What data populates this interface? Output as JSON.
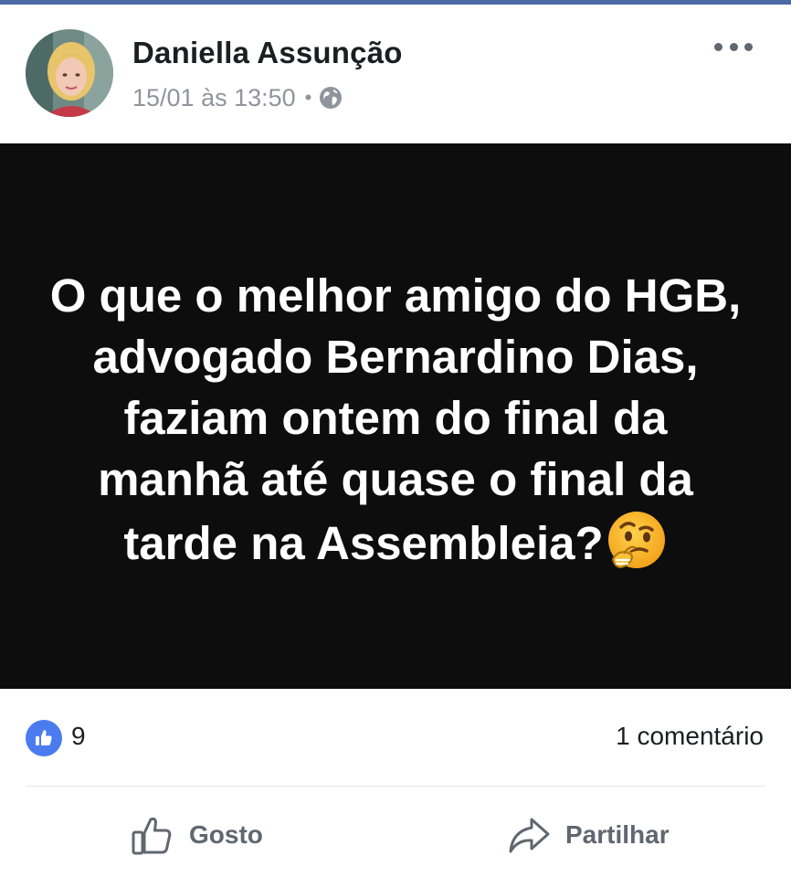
{
  "post": {
    "author": "Daniella Assunção",
    "timestamp": "15/01 às 13:50",
    "separator": "•",
    "privacy_icon": "globe-icon",
    "menu_icon": "more-options-icon",
    "image_text": "O que o melhor amigo do HGB, advogado Bernardino Dias, faziam ontem do final da manhã até quase o final da tarde na Assembleia?",
    "image_emoji": "thinking-face-emoji"
  },
  "stats": {
    "reaction_icon": "like-reaction-icon",
    "likes": "9",
    "comments": "1 comentário"
  },
  "actions": {
    "like_label": "Gosto",
    "like_icon": "thumbs-up-icon",
    "share_label": "Partilhar",
    "share_icon": "share-arrow-icon"
  },
  "colors": {
    "accent_bar": "#4a6aa5",
    "reaction_blue": "#4a7cf0",
    "image_background": "#0d0d0d",
    "meta_gray": "#90949c"
  }
}
